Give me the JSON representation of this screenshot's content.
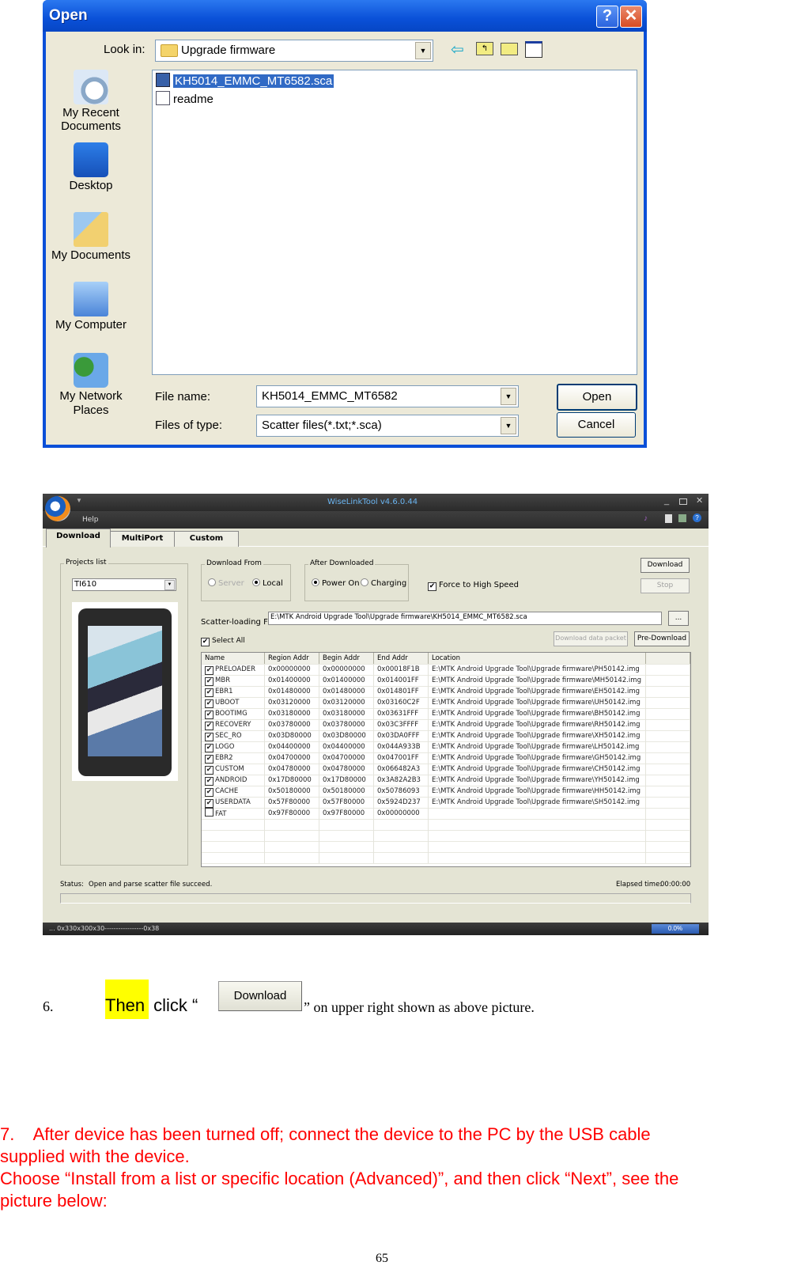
{
  "open_dialog": {
    "title": "Open",
    "look_in_label": "Look in:",
    "look_in_value": "Upgrade firmware",
    "places": [
      "My Recent Documents",
      "Desktop",
      "My Documents",
      "My Computer",
      "My Network Places"
    ],
    "files": [
      {
        "name": "KH5014_EMMC_MT6582.sca",
        "selected": true,
        "icon": "scatter-file-icon"
      },
      {
        "name": "readme",
        "selected": false,
        "icon": "text-file-icon"
      }
    ],
    "file_name_label": "File name:",
    "file_name_value": "KH5014_EMMC_MT6582",
    "file_type_label": "Files of type:",
    "file_type_value": "Scatter files(*.txt;*.sca)",
    "open_label": "Open",
    "cancel_label": "Cancel",
    "help_glyph": "?",
    "close_glyph": "✕"
  },
  "wiselink": {
    "title": "WiseLinkTool v4.6.0.44",
    "menu_help": "Help",
    "tabs": [
      "Download",
      "MultiPort",
      "Custom"
    ],
    "projects_list_label": "Projects list",
    "project_value": "TI610",
    "download_from_label": "Download From",
    "download_from_options": [
      "Server",
      "Local"
    ],
    "download_from_selected": "Local",
    "after_downloaded_label": "After Downloaded",
    "after_downloaded_options": [
      "Power On",
      "Charging"
    ],
    "after_downloaded_selected": "Power On",
    "force_high_speed_label": "Force to High Speed",
    "force_high_speed_checked": true,
    "download_button": "Download",
    "stop_button": "Stop",
    "scatter_label": "Scatter-loading File:",
    "scatter_value": "E:\\MTK Android Upgrade Tool\\Upgrade firmware\\KH5014_EMMC_MT6582.sca",
    "browse_button": "...",
    "select_all_label": "Select All",
    "download_data_packet_button": "Download data packet",
    "pre_download_button": "Pre-Download",
    "columns": [
      "Name",
      "Region Addr",
      "Begin Addr",
      "End Addr",
      "Location"
    ],
    "rows": [
      {
        "checked": true,
        "name": "PRELOADER",
        "region": "0x00000000",
        "begin": "0x00000000",
        "end": "0x00018F1B",
        "location": "E:\\MTK Android Upgrade Tool\\Upgrade firmware\\PH50142.img"
      },
      {
        "checked": true,
        "name": "MBR",
        "region": "0x01400000",
        "begin": "0x01400000",
        "end": "0x014001FF",
        "location": "E:\\MTK Android Upgrade Tool\\Upgrade firmware\\MH50142.img"
      },
      {
        "checked": true,
        "name": "EBR1",
        "region": "0x01480000",
        "begin": "0x01480000",
        "end": "0x014801FF",
        "location": "E:\\MTK Android Upgrade Tool\\Upgrade firmware\\EH50142.img"
      },
      {
        "checked": true,
        "name": "UBOOT",
        "region": "0x03120000",
        "begin": "0x03120000",
        "end": "0x03160C2F",
        "location": "E:\\MTK Android Upgrade Tool\\Upgrade firmware\\UH50142.img"
      },
      {
        "checked": true,
        "name": "BOOTIMG",
        "region": "0x03180000",
        "begin": "0x03180000",
        "end": "0x03631FFF",
        "location": "E:\\MTK Android Upgrade Tool\\Upgrade firmware\\BH50142.img"
      },
      {
        "checked": true,
        "name": "RECOVERY",
        "region": "0x03780000",
        "begin": "0x03780000",
        "end": "0x03C3FFFF",
        "location": "E:\\MTK Android Upgrade Tool\\Upgrade firmware\\RH50142.img"
      },
      {
        "checked": true,
        "name": "SEC_RO",
        "region": "0x03D80000",
        "begin": "0x03D80000",
        "end": "0x03DA0FFF",
        "location": "E:\\MTK Android Upgrade Tool\\Upgrade firmware\\XH50142.img"
      },
      {
        "checked": true,
        "name": "LOGO",
        "region": "0x04400000",
        "begin": "0x04400000",
        "end": "0x044A933B",
        "location": "E:\\MTK Android Upgrade Tool\\Upgrade firmware\\LH50142.img"
      },
      {
        "checked": true,
        "name": "EBR2",
        "region": "0x04700000",
        "begin": "0x04700000",
        "end": "0x047001FF",
        "location": "E:\\MTK Android Upgrade Tool\\Upgrade firmware\\GH50142.img"
      },
      {
        "checked": true,
        "name": "CUSTOM",
        "region": "0x04780000",
        "begin": "0x04780000",
        "end": "0x066482A3",
        "location": "E:\\MTK Android Upgrade Tool\\Upgrade firmware\\CH50142.img"
      },
      {
        "checked": true,
        "name": "ANDROID",
        "region": "0x17D80000",
        "begin": "0x17D80000",
        "end": "0x3A82A2B3",
        "location": "E:\\MTK Android Upgrade Tool\\Upgrade firmware\\YH50142.img"
      },
      {
        "checked": true,
        "name": "CACHE",
        "region": "0x50180000",
        "begin": "0x50180000",
        "end": "0x50786093",
        "location": "E:\\MTK Android Upgrade Tool\\Upgrade firmware\\HH50142.img"
      },
      {
        "checked": true,
        "name": "USERDATA",
        "region": "0x57F80000",
        "begin": "0x57F80000",
        "end": "0x5924D237",
        "location": "E:\\MTK Android Upgrade Tool\\Upgrade firmware\\SH50142.img"
      },
      {
        "checked": false,
        "name": "FAT",
        "region": "0x97F80000",
        "begin": "0x97F80000",
        "end": "0x00000000",
        "location": ""
      }
    ],
    "status_label": "Status:",
    "status_value": "Open and parse scatter file succeed.",
    "elapsed_label": "Elapsed time:",
    "elapsed_value": "00:00:00",
    "footer_left": "... 0x330x300x30-----------------0x38",
    "footer_progress": "0.0%",
    "progress_fraction": 0.0
  },
  "step6": {
    "number": "6.",
    "highlight": "Then",
    "text_before": " click “",
    "button_label": "Download",
    "text_after": "” on upper right shown as above picture."
  },
  "step7": {
    "line1": "7.    After device has been turned off; connect the device to the PC by the USB cable",
    "line2": "supplied with the device.",
    "line3": "Choose “Install from a list or specific location (Advanced)”, and then click “Next”, see the",
    "line4": "picture below:"
  },
  "page_number": "65"
}
